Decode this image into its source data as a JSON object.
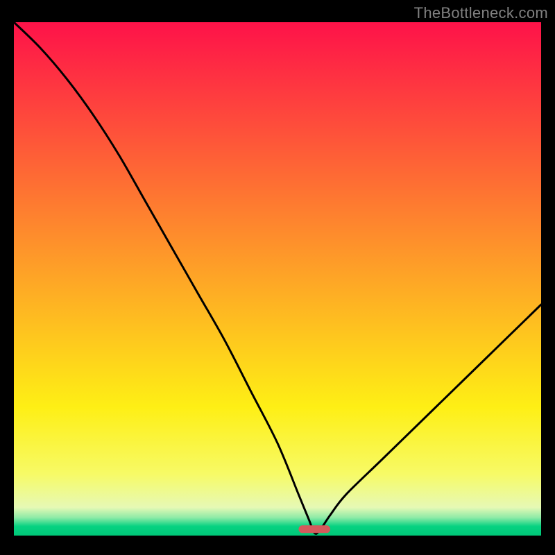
{
  "watermark": "TheBottleneck.com",
  "chart_data": {
    "type": "line",
    "title": "",
    "xlabel": "",
    "ylabel": "",
    "xlim": [
      0,
      100
    ],
    "ylim": [
      0,
      100
    ],
    "grid": false,
    "legend": false,
    "background": {
      "type": "vertical-gradient",
      "description": "red-orange-yellow-green with a final crisp bright-green band at the bottom",
      "stops": [
        {
          "offset": 0.0,
          "color": "#fe1249"
        },
        {
          "offset": 0.2,
          "color": "#fe4d3b"
        },
        {
          "offset": 0.4,
          "color": "#fe882d"
        },
        {
          "offset": 0.6,
          "color": "#fec31f"
        },
        {
          "offset": 0.75,
          "color": "#feef15"
        },
        {
          "offset": 0.88,
          "color": "#f7fa66"
        },
        {
          "offset": 0.945,
          "color": "#e6f9b5"
        },
        {
          "offset": 0.965,
          "color": "#8eeba7"
        },
        {
          "offset": 0.982,
          "color": "#06d281"
        },
        {
          "offset": 1.0,
          "color": "#00c878"
        }
      ]
    },
    "series": [
      {
        "name": "bottleneck-curve",
        "description": "V-shaped curve starting near 100% at x≈0, descending to ~0 near x≈57, then rising to ~45 at x=100",
        "x": [
          0,
          5,
          10,
          15,
          20,
          25,
          30,
          35,
          40,
          45,
          50,
          54,
          56,
          57,
          58,
          60,
          63,
          70,
          80,
          90,
          100
        ],
        "values": [
          100,
          95,
          89,
          82,
          74,
          65,
          56,
          47,
          38,
          28,
          18,
          8,
          3,
          0.5,
          1,
          4,
          8,
          15,
          25,
          35,
          45
        ]
      }
    ],
    "annotations": [
      {
        "name": "optimal-region-marker",
        "shape": "rounded-bar",
        "x_range": [
          54,
          60
        ],
        "y": 0.5,
        "color": "#d45a5c"
      }
    ]
  }
}
